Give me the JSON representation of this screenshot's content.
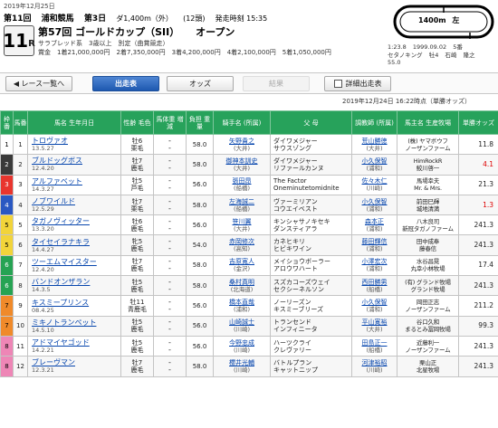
{
  "header": {
    "date": "2019年12月25日",
    "race_no": "第11回",
    "venue": "浦和競馬",
    "day": "第3日",
    "distance": "ダ1,400m（外）",
    "runners": "(12頭)",
    "post_time": "発走時刻 15:35"
  },
  "race": {
    "number": "11",
    "r": "R",
    "name": "第57回 ゴールドカップ（SII）",
    "subtitle": "オープン",
    "conditions": "サラブレッド系　3歳以上　別定（曲賞競走）",
    "prize": "賞金　1着21,000,000円　2着7,350,000円　3着4,200,000円　4着2,100,000円　5着1,050,000円"
  },
  "course": {
    "distance": "1400m",
    "direction": "左"
  },
  "record": {
    "time": "1:23.8",
    "date": "1999.09.02",
    "rank": "5番",
    "horse": "セタノキング",
    "age": "牡4",
    "weight": "55.0",
    "jockey": "石崎",
    "trainer": "隆之"
  },
  "buttons": {
    "back": "◀ レース一覧へ",
    "syusso": "出走表",
    "odds": "オッズ",
    "kekka": "結果",
    "detail": "詳細出走表"
  },
  "updated": "2019年12月24日 16:22時点（単勝オッズ）",
  "table_headers": {
    "waku": "枠番",
    "uma": "馬番",
    "horse": "馬名 生年月日",
    "sex": "性齢 毛色",
    "weight": "馬体重 増減",
    "load": "負担 重量",
    "jockey": "騎手名 (所属)",
    "sire": "父 母",
    "trainer": "調教師 (所属)",
    "owner": "馬主名 生産牧場",
    "odds": "単勝オッズ"
  },
  "waku_colors": [
    "#ffffff",
    "#3a3a3a",
    "#e8352e",
    "#2a58c2",
    "#f2d43a",
    "#26a353",
    "#f08a2a",
    "#ee86b6"
  ],
  "horses": [
    {
      "waku": "1",
      "uma": "1",
      "name": "トロヴァオ",
      "birth": "13.5.27",
      "sex": "牡6",
      "color": "栗毛",
      "weight": "-",
      "diff": "-",
      "load": "58.0",
      "jockey": "矢野貴之",
      "jaff": "(大井)",
      "sire": "ダイワメジャー",
      "dam": "サウスゾング",
      "trainer": "荒山勝徳",
      "taff": "(大井)",
      "owner": "(株) ヤマボウフ",
      "breeder": "ノーザンファーム",
      "odds": "11.8",
      "fav": false
    },
    {
      "waku": "2",
      "uma": "2",
      "name": "ブルドッグボス",
      "birth": "12.4.20",
      "sex": "牡7",
      "color": "鹿毛",
      "weight": "-",
      "diff": "-",
      "load": "58.0",
      "jockey": "御神本訓史",
      "jaff": "(大井)",
      "sire": "ダイワメジャー",
      "dam": "リファールカンヌ",
      "trainer": "小久保智",
      "taff": "(浦和)",
      "owner": "HimRockR",
      "breeder": "鮫川啓一",
      "odds": "4.1",
      "fav": true
    },
    {
      "waku": "3",
      "uma": "3",
      "name": "アルファベット",
      "birth": "14.3.27",
      "sex": "牡5",
      "color": "芦毛",
      "weight": "-",
      "diff": "-",
      "load": "56.0",
      "jockey": "張田昂",
      "jaff": "(船橋)",
      "sire": "The Factor",
      "dam": "Oneminutetomidnite",
      "trainer": "佐々木仁",
      "taff": "(川崎)",
      "owner": "馬場幸夫",
      "breeder": "Mr. & Mrs.",
      "odds": "21.3",
      "fav": false
    },
    {
      "waku": "4",
      "uma": "4",
      "name": "ノブワイルド",
      "birth": "12.5.29",
      "sex": "牡7",
      "color": "栗毛",
      "weight": "-",
      "diff": "-",
      "load": "58.0",
      "jockey": "左海誠二",
      "jaff": "(船橋)",
      "sire": "ヴァーミリアン",
      "dam": "コウエイベスト",
      "trainer": "小久保智",
      "taff": "(浦和)",
      "owner": "前田巳輝",
      "breeder": "城地清満",
      "odds": "1.3",
      "fav": true
    },
    {
      "waku": "5",
      "uma": "5",
      "name": "タガノヴィッター",
      "birth": "13.3.20",
      "sex": "牡6",
      "color": "鹿毛",
      "weight": "-",
      "diff": "-",
      "load": "56.0",
      "jockey": "笹川翼",
      "jaff": "(大井)",
      "sire": "キンシャサノキセキ",
      "dam": "ダンスティアラ",
      "trainer": "森本正",
      "taff": "(浦和)",
      "owner": "八木良司",
      "breeder": "新冠タガノファーム",
      "odds": "241.3",
      "fav": false
    },
    {
      "waku": "5",
      "uma": "6",
      "name": "タイセイラナキラ",
      "birth": "14.4.27",
      "sex": "牝5",
      "color": "鹿毛",
      "weight": "-",
      "diff": "-",
      "load": "54.0",
      "jockey": "赤岡修次",
      "jaff": "(高知)",
      "sire": "カネヒキリ",
      "dam": "ヒビキワイン",
      "trainer": "藤田輝信",
      "taff": "(浦和)",
      "owner": "田中成奉",
      "breeder": "藤春信",
      "odds": "241.3",
      "fav": false
    },
    {
      "waku": "6",
      "uma": "7",
      "name": "ツーエムマイスター",
      "birth": "12.4.20",
      "sex": "牡7",
      "color": "鹿毛",
      "weight": "-",
      "diff": "-",
      "load": "58.0",
      "jockey": "吉原寛人",
      "jaff": "(金沢)",
      "sire": "メイショウボーラー",
      "dam": "アロウワハート",
      "trainer": "小澤宏次",
      "taff": "(浦和)",
      "owner": "水谷昌晃",
      "breeder": "丸幸小林牧場",
      "odds": "17.4",
      "fav": false
    },
    {
      "waku": "6",
      "uma": "8",
      "name": "バンドオンザラン",
      "birth": "14.3.5",
      "sex": "牡5",
      "color": "鹿毛",
      "weight": "-",
      "diff": "-",
      "load": "58.0",
      "jockey": "桑村真明",
      "jaff": "(北海道)",
      "sire": "スズカコーズウェイ",
      "dam": "セクシーネルソン",
      "trainer": "西田勝男",
      "taff": "(船橋)",
      "owner": "(有) グランド牧場",
      "breeder": "グランド牧場",
      "odds": "241.3",
      "fav": false
    },
    {
      "waku": "7",
      "uma": "9",
      "name": "キスミープリンス",
      "birth": "08.4.25",
      "sex": "牡11",
      "color": "青鹿毛",
      "weight": "-",
      "diff": "-",
      "load": "56.0",
      "jockey": "橋本直哉",
      "jaff": "(浦和)",
      "sire": "ノーリーズン",
      "dam": "キスミーブリーズ",
      "trainer": "小久保智",
      "taff": "(浦和)",
      "owner": "岡田正志",
      "breeder": "ノーザンファーム",
      "odds": "211.2",
      "fav": false
    },
    {
      "waku": "7",
      "uma": "10",
      "name": "ミキノトランペット",
      "birth": "14.5.10",
      "sex": "牡5",
      "color": "鹿毛",
      "weight": "-",
      "diff": "-",
      "load": "56.0",
      "jockey": "山崎誠士",
      "jaff": "(川崎)",
      "sire": "トランセンド",
      "dam": "インフィニータ",
      "trainer": "平山寛裕",
      "taff": "(大井)",
      "owner": "谷口久和",
      "breeder": "まるとみ冨岡牧場",
      "odds": "99.3",
      "fav": false
    },
    {
      "waku": "8",
      "uma": "11",
      "name": "アドマイヤゴッド",
      "birth": "14.2.21",
      "sex": "牡5",
      "color": "鹿毛",
      "weight": "-",
      "diff": "-",
      "load": "56.0",
      "jockey": "今野忠成",
      "jaff": "(川崎)",
      "sire": "ハーツクライ",
      "dam": "クレヴァリー",
      "trainer": "田島正一",
      "taff": "(船橋)",
      "owner": "近藤利一",
      "breeder": "ノーザンファーム",
      "odds": "241.3",
      "fav": false
    },
    {
      "waku": "8",
      "uma": "12",
      "name": "ブレーヴマン",
      "birth": "12.3.21",
      "sex": "牡7",
      "color": "鹿毛",
      "weight": "-",
      "diff": "-",
      "load": "58.0",
      "jockey": "櫻井光輔",
      "jaff": "(川崎)",
      "sire": "バトルプラン",
      "dam": "キャットニップ",
      "trainer": "河津裕昭",
      "taff": "(川崎)",
      "owner": "栗山正",
      "breeder": "北星牧場",
      "odds": "241.3",
      "fav": false
    }
  ]
}
